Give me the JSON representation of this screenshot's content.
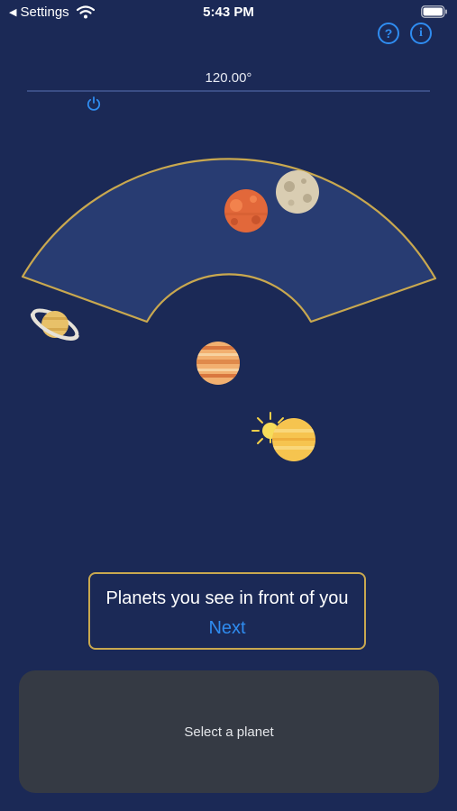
{
  "status_bar": {
    "back_label": "Settings",
    "time": "5:43 PM"
  },
  "header": {
    "help_label": "?",
    "info_label": "i"
  },
  "slider": {
    "value_label": "120.00°"
  },
  "scene": {
    "planets": [
      "mars",
      "moon",
      "saturn",
      "jupiter",
      "sun",
      "venus"
    ]
  },
  "prompt": {
    "title": "Planets you see in front of you",
    "next_label": "Next"
  },
  "info_panel": {
    "text": "Select a planet"
  },
  "colors": {
    "background": "#1b2956",
    "field_of_view": "#283c72",
    "field_border": "#c9a84f",
    "accent_blue": "#2f8cf0",
    "panel": "#353a44"
  }
}
